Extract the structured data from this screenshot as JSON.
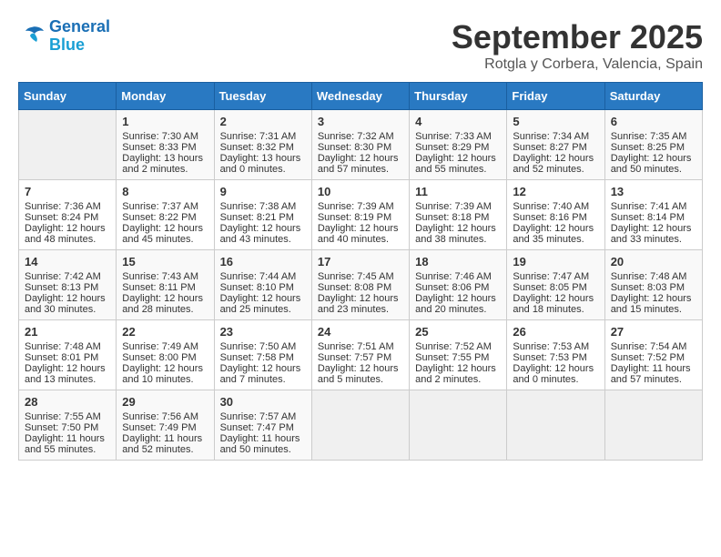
{
  "header": {
    "logo_line1": "General",
    "logo_line2": "Blue",
    "month": "September 2025",
    "location": "Rotgla y Corbera, Valencia, Spain"
  },
  "days_of_week": [
    "Sunday",
    "Monday",
    "Tuesday",
    "Wednesday",
    "Thursday",
    "Friday",
    "Saturday"
  ],
  "weeks": [
    [
      {
        "day": null
      },
      {
        "day": "1",
        "sunrise": "7:30 AM",
        "sunset": "8:33 PM",
        "daylight": "13 hours and 2 minutes."
      },
      {
        "day": "2",
        "sunrise": "7:31 AM",
        "sunset": "8:32 PM",
        "daylight": "13 hours and 0 minutes."
      },
      {
        "day": "3",
        "sunrise": "7:32 AM",
        "sunset": "8:30 PM",
        "daylight": "12 hours and 57 minutes."
      },
      {
        "day": "4",
        "sunrise": "7:33 AM",
        "sunset": "8:29 PM",
        "daylight": "12 hours and 55 minutes."
      },
      {
        "day": "5",
        "sunrise": "7:34 AM",
        "sunset": "8:27 PM",
        "daylight": "12 hours and 52 minutes."
      },
      {
        "day": "6",
        "sunrise": "7:35 AM",
        "sunset": "8:25 PM",
        "daylight": "12 hours and 50 minutes."
      }
    ],
    [
      {
        "day": "7",
        "sunrise": "7:36 AM",
        "sunset": "8:24 PM",
        "daylight": "12 hours and 48 minutes."
      },
      {
        "day": "8",
        "sunrise": "7:37 AM",
        "sunset": "8:22 PM",
        "daylight": "12 hours and 45 minutes."
      },
      {
        "day": "9",
        "sunrise": "7:38 AM",
        "sunset": "8:21 PM",
        "daylight": "12 hours and 43 minutes."
      },
      {
        "day": "10",
        "sunrise": "7:39 AM",
        "sunset": "8:19 PM",
        "daylight": "12 hours and 40 minutes."
      },
      {
        "day": "11",
        "sunrise": "7:39 AM",
        "sunset": "8:18 PM",
        "daylight": "12 hours and 38 minutes."
      },
      {
        "day": "12",
        "sunrise": "7:40 AM",
        "sunset": "8:16 PM",
        "daylight": "12 hours and 35 minutes."
      },
      {
        "day": "13",
        "sunrise": "7:41 AM",
        "sunset": "8:14 PM",
        "daylight": "12 hours and 33 minutes."
      }
    ],
    [
      {
        "day": "14",
        "sunrise": "7:42 AM",
        "sunset": "8:13 PM",
        "daylight": "12 hours and 30 minutes."
      },
      {
        "day": "15",
        "sunrise": "7:43 AM",
        "sunset": "8:11 PM",
        "daylight": "12 hours and 28 minutes."
      },
      {
        "day": "16",
        "sunrise": "7:44 AM",
        "sunset": "8:10 PM",
        "daylight": "12 hours and 25 minutes."
      },
      {
        "day": "17",
        "sunrise": "7:45 AM",
        "sunset": "8:08 PM",
        "daylight": "12 hours and 23 minutes."
      },
      {
        "day": "18",
        "sunrise": "7:46 AM",
        "sunset": "8:06 PM",
        "daylight": "12 hours and 20 minutes."
      },
      {
        "day": "19",
        "sunrise": "7:47 AM",
        "sunset": "8:05 PM",
        "daylight": "12 hours and 18 minutes."
      },
      {
        "day": "20",
        "sunrise": "7:48 AM",
        "sunset": "8:03 PM",
        "daylight": "12 hours and 15 minutes."
      }
    ],
    [
      {
        "day": "21",
        "sunrise": "7:48 AM",
        "sunset": "8:01 PM",
        "daylight": "12 hours and 13 minutes."
      },
      {
        "day": "22",
        "sunrise": "7:49 AM",
        "sunset": "8:00 PM",
        "daylight": "12 hours and 10 minutes."
      },
      {
        "day": "23",
        "sunrise": "7:50 AM",
        "sunset": "7:58 PM",
        "daylight": "12 hours and 7 minutes."
      },
      {
        "day": "24",
        "sunrise": "7:51 AM",
        "sunset": "7:57 PM",
        "daylight": "12 hours and 5 minutes."
      },
      {
        "day": "25",
        "sunrise": "7:52 AM",
        "sunset": "7:55 PM",
        "daylight": "12 hours and 2 minutes."
      },
      {
        "day": "26",
        "sunrise": "7:53 AM",
        "sunset": "7:53 PM",
        "daylight": "12 hours and 0 minutes."
      },
      {
        "day": "27",
        "sunrise": "7:54 AM",
        "sunset": "7:52 PM",
        "daylight": "11 hours and 57 minutes."
      }
    ],
    [
      {
        "day": "28",
        "sunrise": "7:55 AM",
        "sunset": "7:50 PM",
        "daylight": "11 hours and 55 minutes."
      },
      {
        "day": "29",
        "sunrise": "7:56 AM",
        "sunset": "7:49 PM",
        "daylight": "11 hours and 52 minutes."
      },
      {
        "day": "30",
        "sunrise": "7:57 AM",
        "sunset": "7:47 PM",
        "daylight": "11 hours and 50 minutes."
      },
      {
        "day": null
      },
      {
        "day": null
      },
      {
        "day": null
      },
      {
        "day": null
      }
    ]
  ]
}
